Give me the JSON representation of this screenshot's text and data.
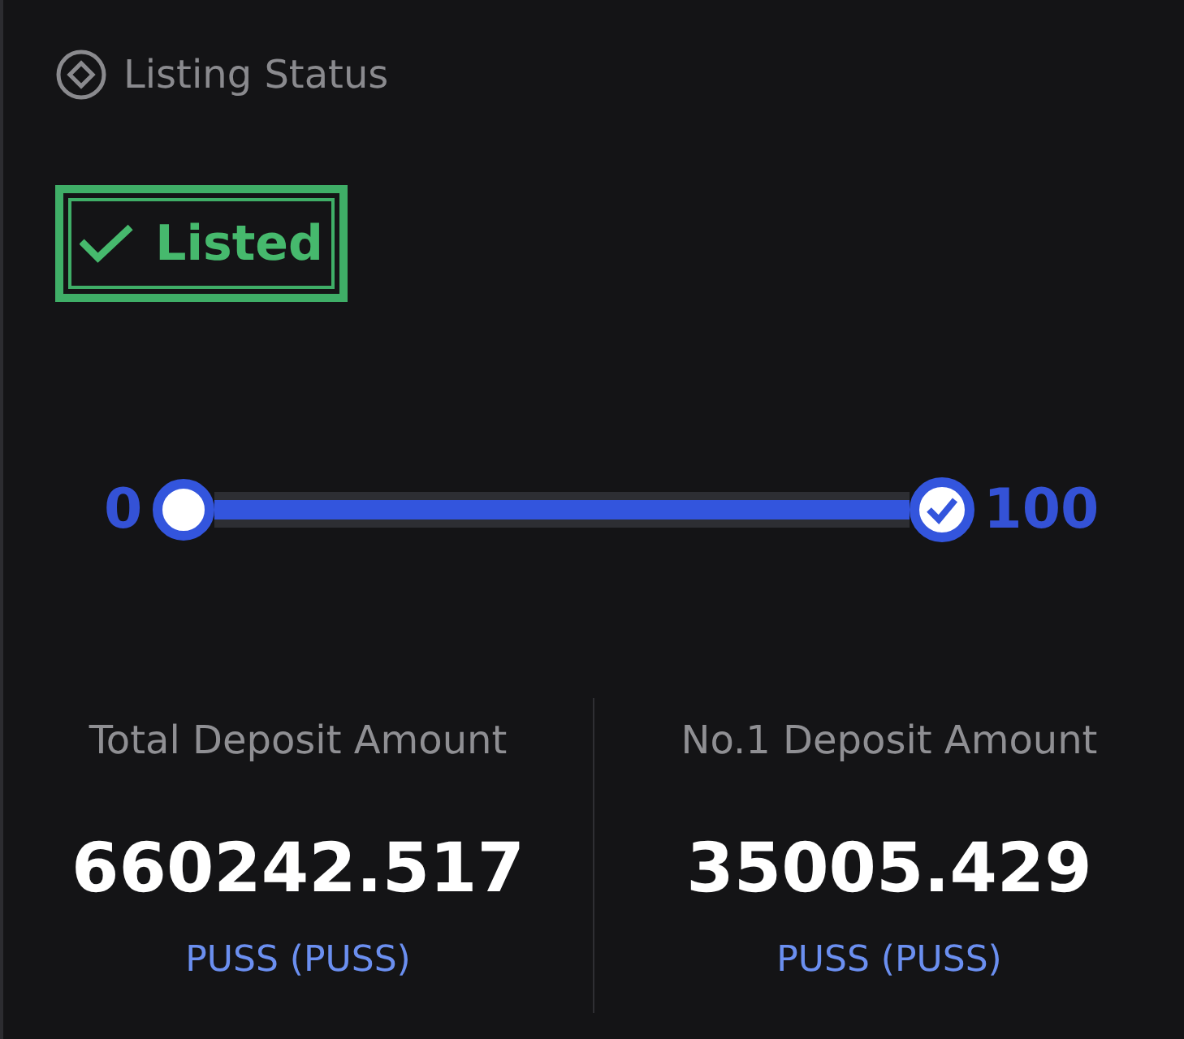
{
  "section": {
    "title": "Listing Status"
  },
  "status_stamp": {
    "label": "Listed"
  },
  "progress": {
    "start_label": "0",
    "end_label": "100",
    "level": 1
  },
  "stats": [
    {
      "label": "Total Deposit Amount",
      "value": "660242.517",
      "unit": "PUSS (PUSS)"
    },
    {
      "label": "No.1 Deposit Amount",
      "value": "35005.429",
      "unit": "PUSS (PUSS)"
    }
  ]
}
